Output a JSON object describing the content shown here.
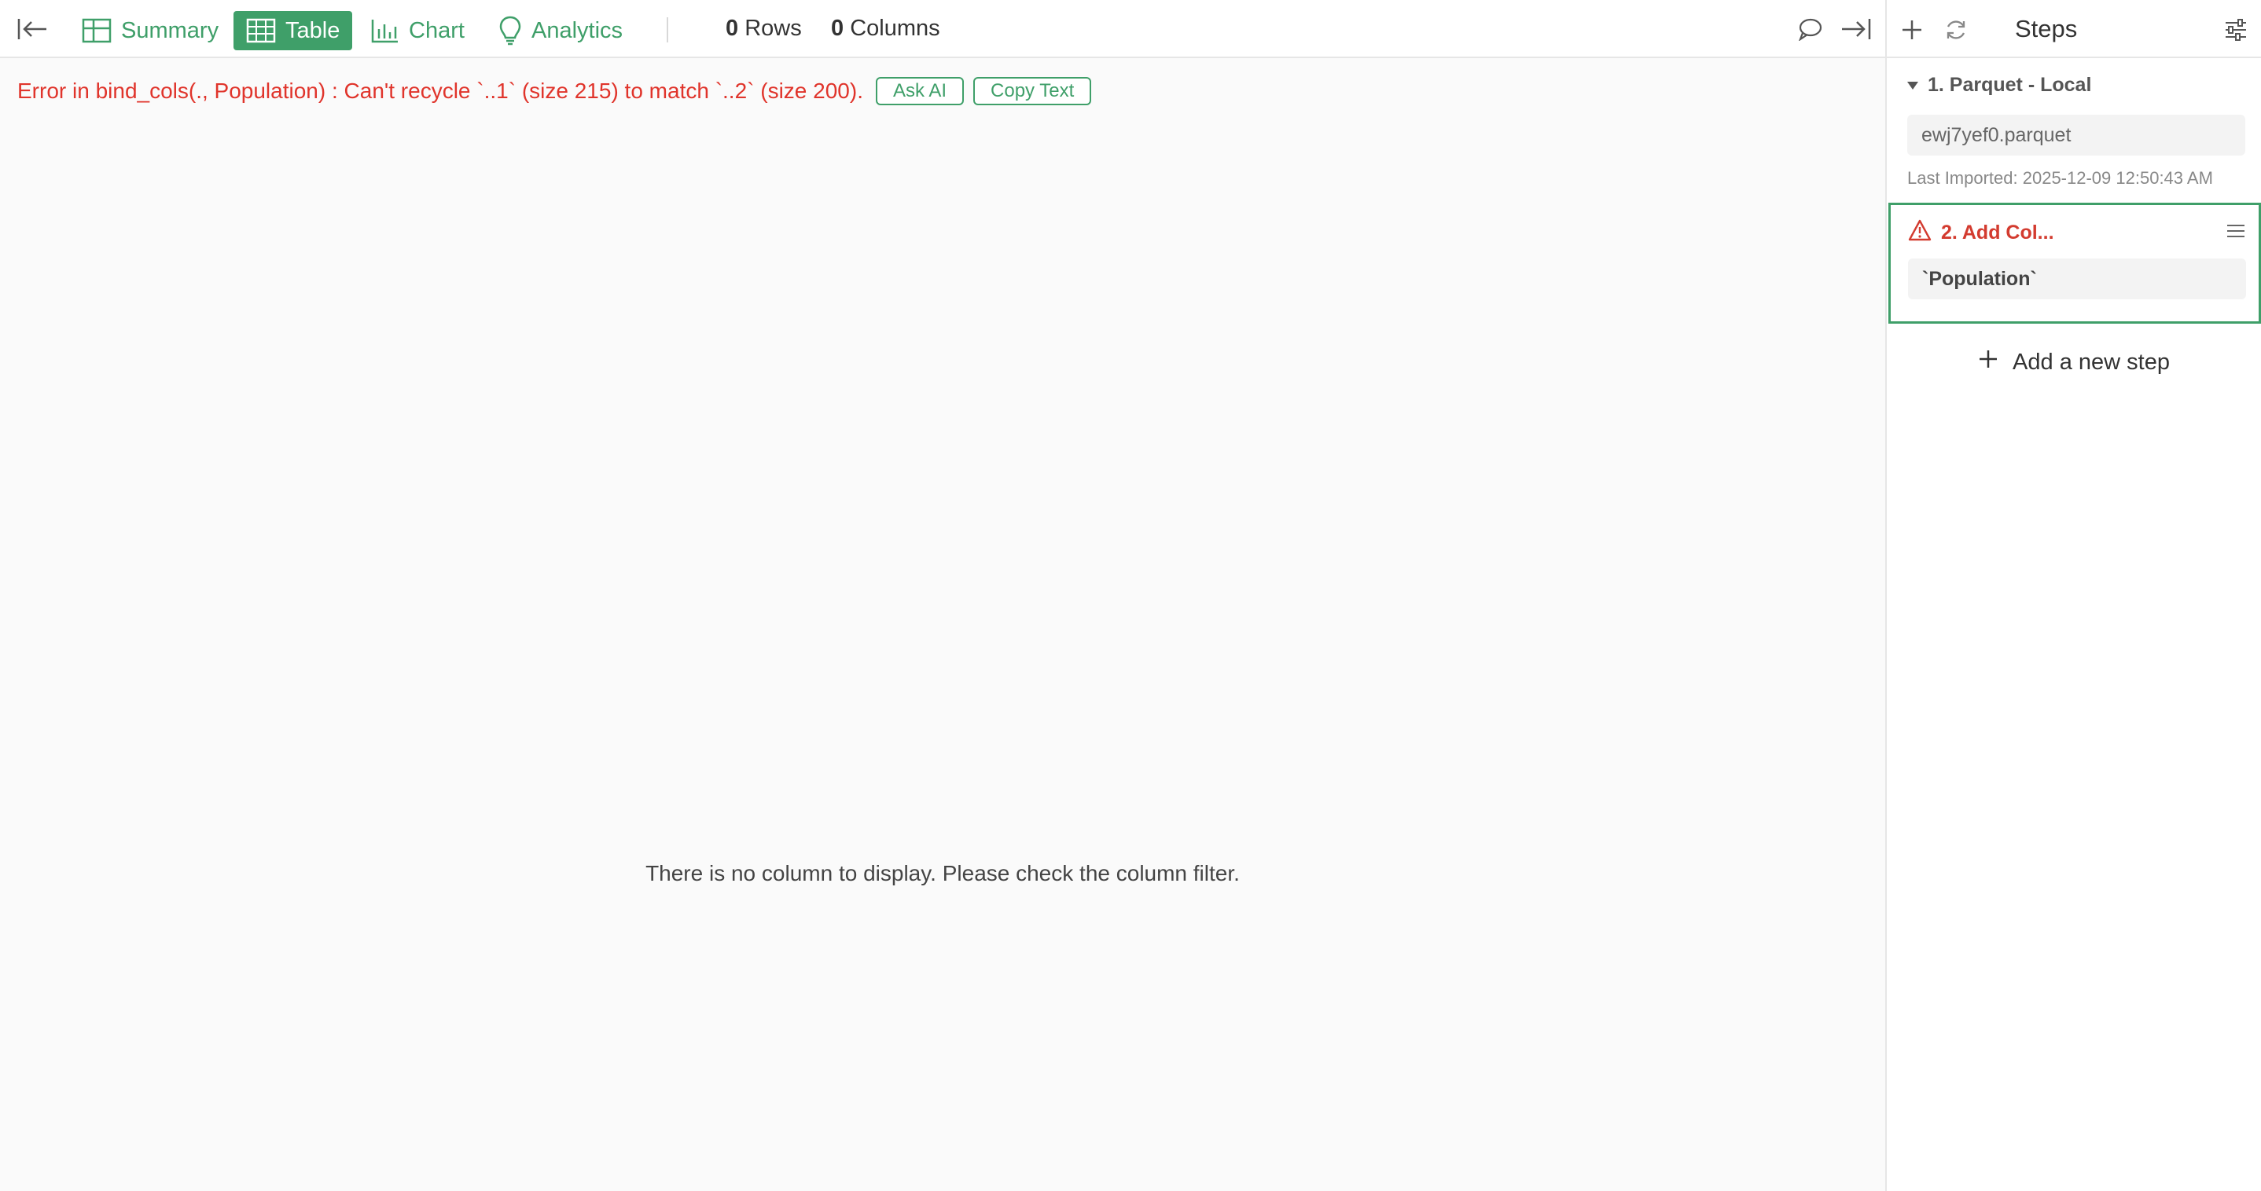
{
  "toolbar": {
    "tabs": [
      {
        "label": "Summary",
        "icon": "grid-icon"
      },
      {
        "label": "Table",
        "icon": "table-icon",
        "active": true
      },
      {
        "label": "Chart",
        "icon": "bar-chart-icon"
      },
      {
        "label": "Analytics",
        "icon": "lightbulb-icon"
      }
    ],
    "rows_count": "0",
    "rows_label": "Rows",
    "columns_count": "0",
    "columns_label": "Columns"
  },
  "error": {
    "message": "Error in bind_cols(., Population) : Can't recycle `..1` (size 215) to match `..2` (size 200).",
    "ask_ai_label": "Ask AI",
    "copy_text_label": "Copy Text"
  },
  "main": {
    "empty_message": "There is no column to display. Please check the column filter."
  },
  "steps": {
    "title": "Steps",
    "items": [
      {
        "title": "1. Parquet - Local",
        "file": "ewj7yef0.parquet",
        "last_imported": "Last Imported: 2025-12-09 12:50:43 AM"
      },
      {
        "title": "2. Add Col...",
        "value": "`Population`",
        "status": "error"
      }
    ],
    "add_label": "Add a new step"
  },
  "colors": {
    "accent": "#3f9f69",
    "error": "#e0342b",
    "background": "#fafafa"
  }
}
